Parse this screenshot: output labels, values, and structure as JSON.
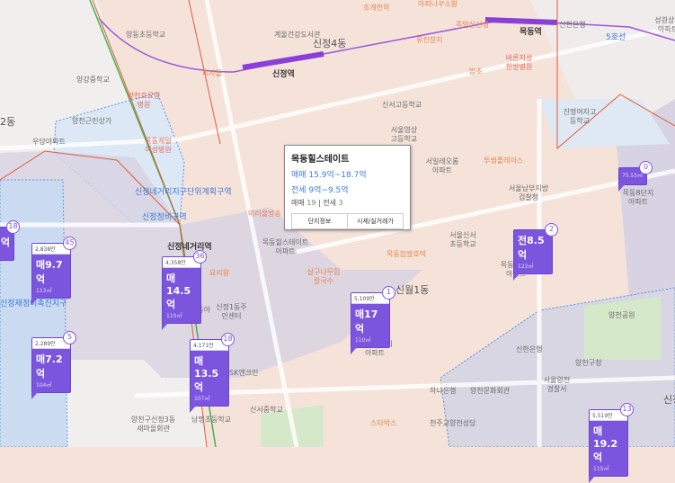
{
  "popup": {
    "title": "목동힐스테이트",
    "sale": "매매 15.9억~18.7억",
    "jeonse": "전세 9억~9.5억",
    "sale_count_label": "매매",
    "sale_count": "19",
    "jeonse_count_label": "전세",
    "jeonse_count": "3",
    "btn_info": "단지정보",
    "btn_price": "시세/실거래가"
  },
  "markers": [
    {
      "top": "",
      "price": "억",
      "area": "",
      "count": "18"
    },
    {
      "top": "2,838만",
      "price": "매9.7억",
      "area": "113㎡",
      "count": "45"
    },
    {
      "top": "4,358만",
      "price": "매14.5억",
      "area": "110㎡",
      "count": "36"
    },
    {
      "top": "2,289만",
      "price": "매7.2억",
      "area": "104㎡",
      "count": "5"
    },
    {
      "top": "4,171만",
      "price": "매13.5억",
      "area": "107㎡",
      "count": "18"
    },
    {
      "top": "5,109만",
      "price": "매17억",
      "area": "110㎡",
      "count": "1"
    },
    {
      "top": "",
      "price": "전8.5억",
      "area": "122㎡",
      "count": "2"
    },
    {
      "top": "",
      "price": "",
      "area": "75.55㎡",
      "count": "0"
    },
    {
      "top": "5,519만",
      "price": "매19.2억",
      "area": "115㎡",
      "count": "13"
    }
  ],
  "labels": [
    "양동초등학교",
    "계울건강도서관",
    "신정4동",
    "신정역",
    "피자몰",
    "양강중학교",
    "양천효요양병원",
    "양천근린상가",
    "2동",
    "우당아파트",
    "목동제일여성병원",
    "신정네거리지구단위계획구역",
    "신정정비구역",
    "신정네거리역",
    "미러물방송",
    "목동힐스테이트아파트",
    "살구나무집칼국수",
    "신정재정비촉진지구",
    "레미안목동아델리체",
    "요리왕",
    "신정1동주민센터",
    "SK엔크린",
    "신서중학교",
    "남명초등학교",
    "양천구신정3동새마을회관",
    "조개천하",
    "아피나꾸소왕",
    "족발신선생",
    "유진장치",
    "밥초",
    "목동역",
    "신한은행",
    "바른지성한방병원",
    "신서고등학교",
    "서울영상고등학교",
    "진명여자고등학교",
    "서일레오롬아파트",
    "투썸플레이스",
    "서울남부지방검찰청",
    "서울신서초등학교",
    "목동잡쌀호떡",
    "목동9단지아파트",
    "목동8단지아파트",
    "신월1동",
    "목동10단지아파트",
    "양천공원",
    "신한은행",
    "양천구청",
    "서울양천경찰서",
    "하나은행",
    "양천문화회관",
    "스타벅스",
    "천주교양천성당",
    "5호선",
    "성원상떼아파트",
    "신정"
  ]
}
